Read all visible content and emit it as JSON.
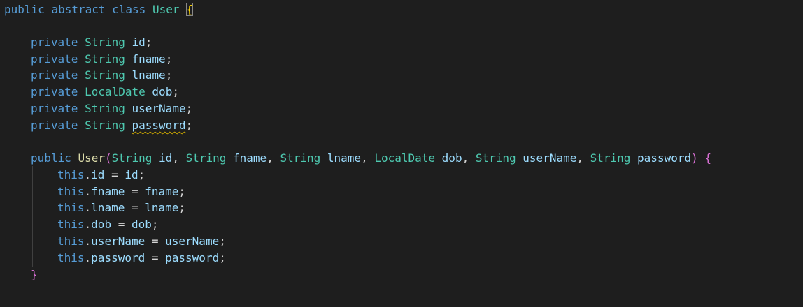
{
  "code": {
    "line1": {
      "kw_public": "public",
      "kw_abstract": "abstract",
      "kw_class": "class",
      "class_name": "User",
      "open_brace": "{"
    },
    "fields": [
      {
        "modifier": "private",
        "type": "String",
        "name": "id",
        "end": ";"
      },
      {
        "modifier": "private",
        "type": "String",
        "name": "fname",
        "end": ";"
      },
      {
        "modifier": "private",
        "type": "String",
        "name": "lname",
        "end": ";"
      },
      {
        "modifier": "private",
        "type": "LocalDate",
        "name": "dob",
        "end": ";"
      },
      {
        "modifier": "private",
        "type": "String",
        "name": "userName",
        "end": ";"
      },
      {
        "modifier": "private",
        "type": "String",
        "name": "password",
        "end": ";",
        "warning": true
      }
    ],
    "constructor": {
      "modifier": "public",
      "name": "User",
      "open_paren": "(",
      "params": [
        {
          "type": "String",
          "name": "id"
        },
        {
          "type": "String",
          "name": "fname"
        },
        {
          "type": "String",
          "name": "lname"
        },
        {
          "type": "LocalDate",
          "name": "dob"
        },
        {
          "type": "String",
          "name": "userName"
        },
        {
          "type": "String",
          "name": "password"
        }
      ],
      "close_paren": ")",
      "open_brace": "{",
      "close_brace": "}"
    },
    "assignments": [
      {
        "this": "this",
        "field": "id",
        "value": "id"
      },
      {
        "this": "this",
        "field": "fname",
        "value": "fname"
      },
      {
        "this": "this",
        "field": "lname",
        "value": "lname"
      },
      {
        "this": "this",
        "field": "dob",
        "value": "dob"
      },
      {
        "this": "this",
        "field": "userName",
        "value": "userName"
      },
      {
        "this": "this",
        "field": "password",
        "value": "password"
      }
    ]
  },
  "colors": {
    "background": "#1e1e1e",
    "keyword": "#569cd6",
    "type": "#4ec9b0",
    "variable": "#9cdcfe",
    "function": "#dcdcaa",
    "brace_level1": "#ffd700",
    "brace_level2": "#da70d6",
    "brace_level3": "#179fff",
    "warning_squiggle": "#cca700"
  }
}
